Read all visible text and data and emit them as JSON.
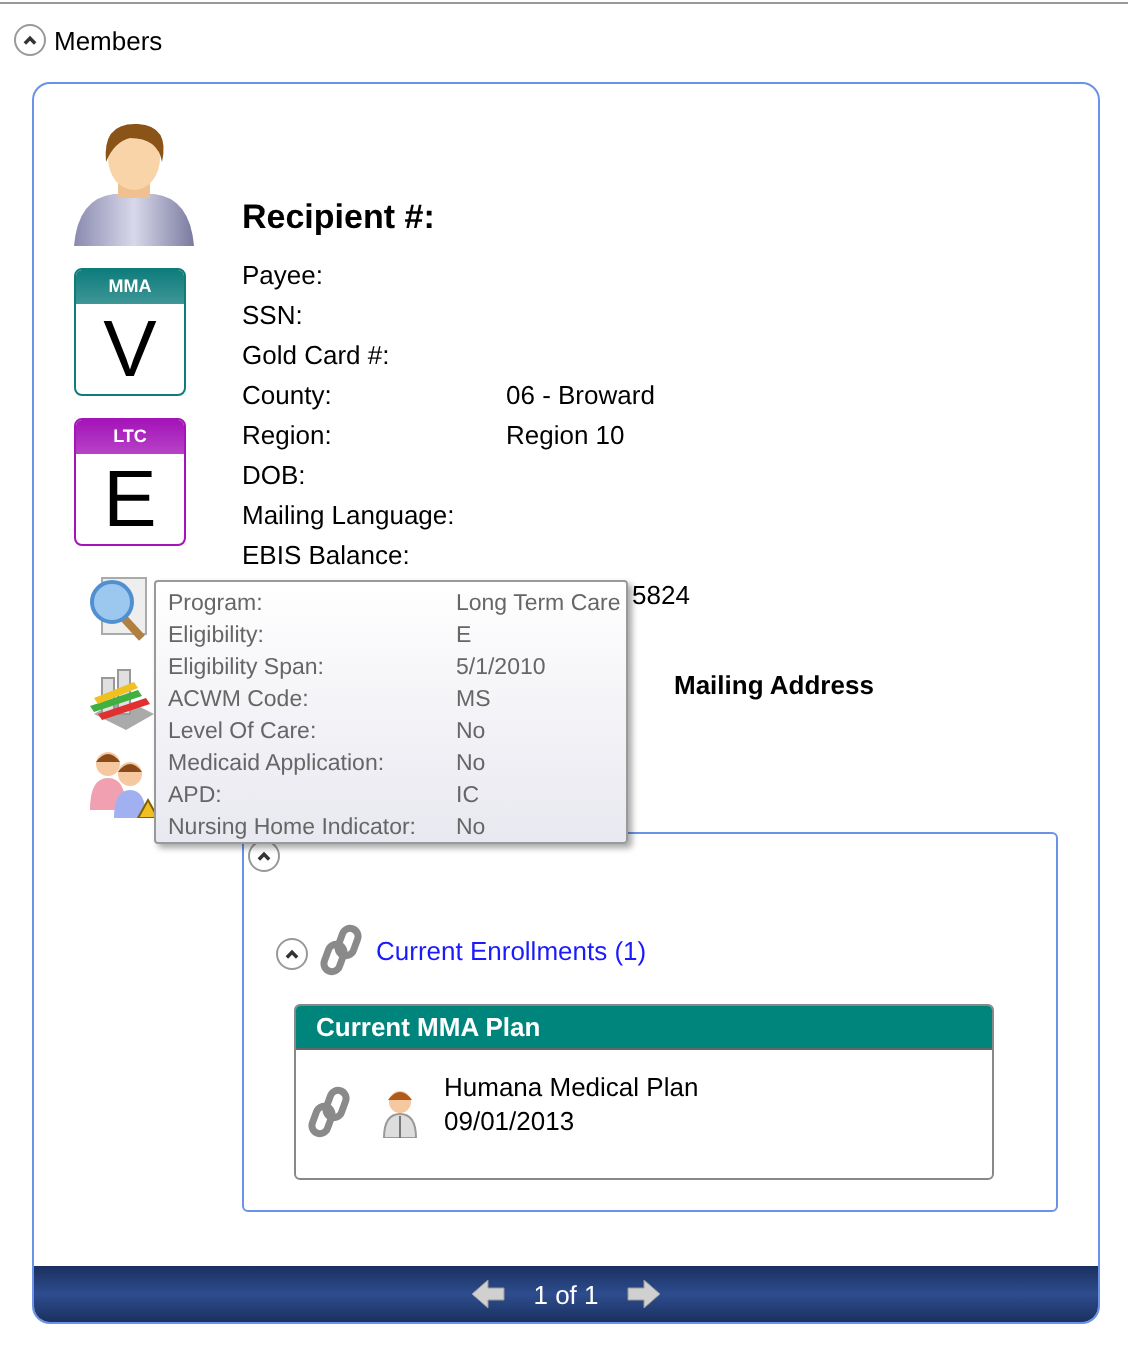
{
  "section": {
    "title": "Members",
    "expanded": true
  },
  "recipient": {
    "heading": "Recipient #:"
  },
  "badges": [
    {
      "program": "MMA",
      "code": "V",
      "color": "#0f7c7c"
    },
    {
      "program": "LTC",
      "code": "E",
      "color": "#a414b8"
    }
  ],
  "fields": [
    {
      "label": "Payee:"
    },
    {
      "label": "SSN:"
    },
    {
      "label": "Gold Card #:"
    },
    {
      "label": "County:",
      "value": "06 - Broward"
    },
    {
      "label": "Region:",
      "value": "Region 10"
    },
    {
      "label": "DOB:"
    },
    {
      "label": "Mailing Language:"
    },
    {
      "label": "EBIS Balance:"
    },
    {
      "value": "5824"
    }
  ],
  "mailing_address": {
    "heading": "Mailing Address"
  },
  "tooltip": {
    "rows": [
      {
        "label": "Program:",
        "value": "Long Term Care"
      },
      {
        "label": "Eligibility:",
        "value": "E"
      },
      {
        "label": "Eligibility Span:",
        "value": "5/1/2010"
      },
      {
        "label": "ACWM Code:",
        "value": "MS"
      },
      {
        "label": "Level Of Care:",
        "value": "No"
      },
      {
        "label": "Medicaid Application:",
        "value": "No"
      },
      {
        "label": "APD:",
        "value": "IC"
      },
      {
        "label": "Nursing Home Indicator:",
        "value": "No"
      }
    ]
  },
  "enrollments": {
    "expanded": true,
    "group": {
      "label": "Current Enrollments (1)",
      "expanded": true
    },
    "plans": [
      {
        "title": "Current MMA Plan",
        "name": "Humana Medical Plan",
        "date": "09/01/2013"
      }
    ]
  },
  "pager": {
    "text": "1 of 1"
  }
}
